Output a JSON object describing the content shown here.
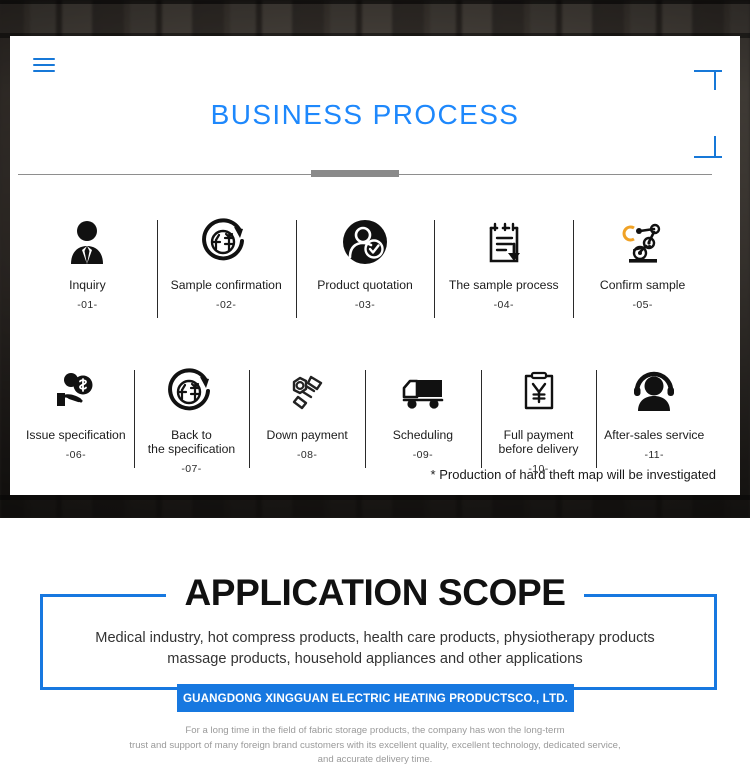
{
  "hero": {
    "alt": "dark blurred warehouse shelving background"
  },
  "card": {
    "menu_icon": "hamburger-menu-icon",
    "title": "BUSINESS PROCESS",
    "bracket_top_icon": "corner-bracket-icon",
    "bracket_bottom_icon": "corner-bracket-icon",
    "footnote": "* Production of hard theft map will be investigated",
    "accent_color": "#1e88fc",
    "divider_color": "#8a8a8a"
  },
  "process": {
    "row1": [
      {
        "label": "Inquiry",
        "number": "-01-",
        "icon": "businessman-icon"
      },
      {
        "label": "Sample confirmation",
        "number": "-02-",
        "icon": "sample-cycle-icon"
      },
      {
        "label": "Product quotation",
        "number": "-03-",
        "icon": "user-check-icon"
      },
      {
        "label": "The sample process",
        "number": "-04-",
        "icon": "document-download-icon"
      },
      {
        "label": "Confirm sample",
        "number": "-05-",
        "icon": "robot-arm-icon"
      }
    ],
    "row2": [
      {
        "label": "Issue specification",
        "number": "-06-",
        "icon": "hand-money-icon"
      },
      {
        "label": "Back to\nthe specification",
        "number": "-07-",
        "icon": "sample-cycle-icon"
      },
      {
        "label": "Down payment",
        "number": "-08-",
        "icon": "bolt-nut-icon"
      },
      {
        "label": "Scheduling",
        "number": "-09-",
        "icon": "delivery-truck-icon"
      },
      {
        "label": "Full payment\nbefore delivery",
        "number": "-10-",
        "icon": "yen-clipboard-icon"
      },
      {
        "label": "After-sales service",
        "number": "-11-",
        "icon": "headset-support-icon"
      }
    ]
  },
  "scope": {
    "title": "APPLICATION SCOPE",
    "description": "Medical industry, hot compress products, health care products, physiotherapy products\nmassage products, household appliances and other applications",
    "company_name": "GUANGDONG XINGGUAN ELECTRIC HEATING PRODUCTSCO., LTD.",
    "company_description": "For a long time in the field of fabric storage products, the company has won the long-term\ntrust and support of many foreign brand customers with its excellent quality, excellent technology, dedicated service,\nand accurate delivery time.",
    "border_color": "#1778e0",
    "banner_color": "#1778e0"
  }
}
